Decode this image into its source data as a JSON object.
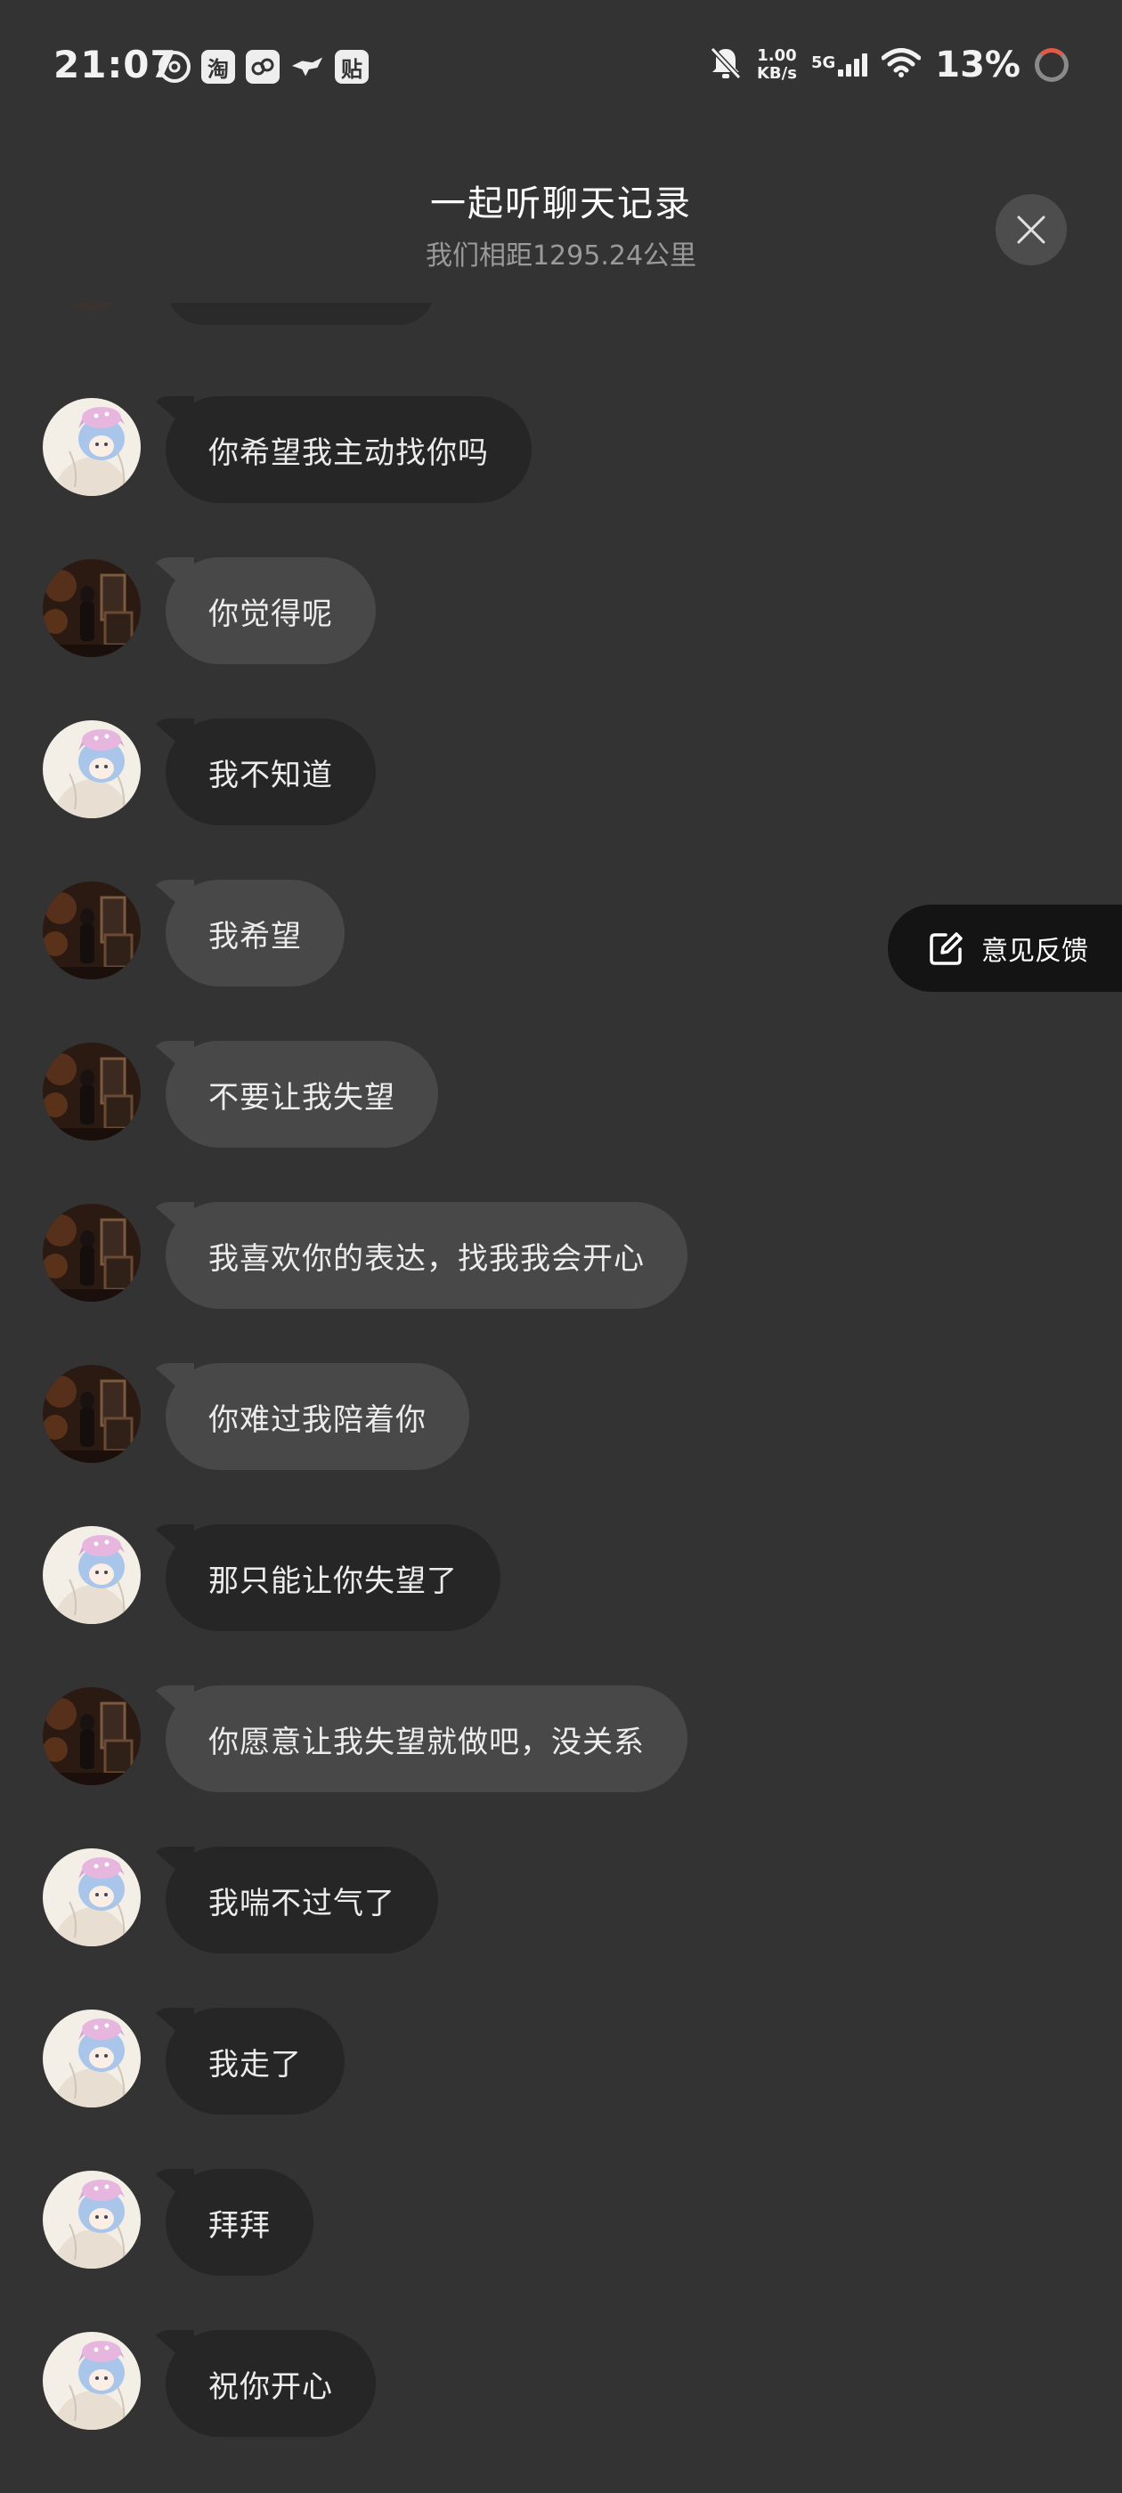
{
  "status_bar": {
    "time": "21:07",
    "app_icons": [
      "netease-music-icon",
      "taobao-icon",
      "link-app-icon",
      "tmall-icon",
      "tieba-icon"
    ],
    "tieba_label": "贴",
    "taobao_label": "淘",
    "net_speed_value": "1.00",
    "net_speed_unit": "KB/s",
    "network_type": "5G",
    "battery_percent": "13%"
  },
  "header": {
    "title": "一起听聊天记录",
    "subtitle": "我们相距1295.24公里"
  },
  "feedback": {
    "label": "意见反馈"
  },
  "messages": [
    {
      "sender": "anime",
      "text": "你希望我主动找你吗",
      "tone": "dark"
    },
    {
      "sender": "dark",
      "text": "你觉得呢",
      "tone": "light"
    },
    {
      "sender": "anime",
      "text": "我不知道",
      "tone": "dark"
    },
    {
      "sender": "dark",
      "text": "我希望",
      "tone": "light"
    },
    {
      "sender": "dark",
      "text": "不要让我失望",
      "tone": "light"
    },
    {
      "sender": "dark",
      "text": "我喜欢你的表达，找我我会开心",
      "tone": "light"
    },
    {
      "sender": "dark",
      "text": "你难过我陪着你",
      "tone": "light"
    },
    {
      "sender": "anime",
      "text": "那只能让你失望了",
      "tone": "dark"
    },
    {
      "sender": "dark",
      "text": "你愿意让我失望就做吧，没关系",
      "tone": "light"
    },
    {
      "sender": "anime",
      "text": "我喘不过气了",
      "tone": "dark"
    },
    {
      "sender": "anime",
      "text": "我走了",
      "tone": "dark"
    },
    {
      "sender": "anime",
      "text": "拜拜",
      "tone": "dark"
    },
    {
      "sender": "anime",
      "text": "祝你开心",
      "tone": "dark"
    }
  ]
}
